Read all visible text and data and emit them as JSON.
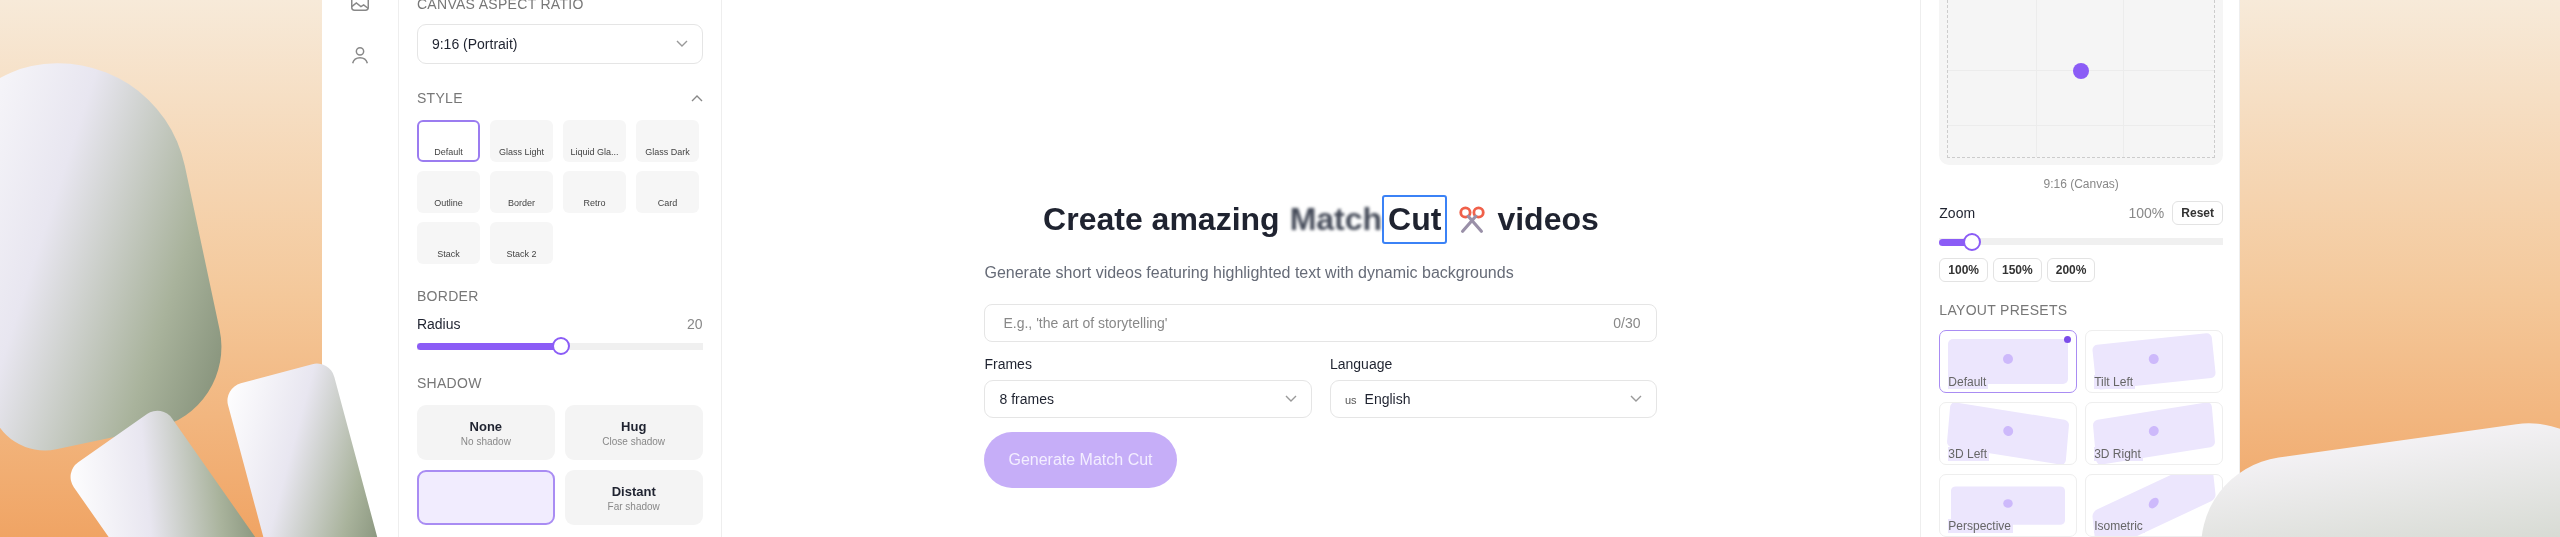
{
  "rail": {
    "items": [
      {
        "kind": "image"
      },
      {
        "kind": "person"
      }
    ]
  },
  "left_panel": {
    "aspect_ratio": {
      "heading": "CANVAS ASPECT RATIO",
      "value": "9:16 (Portrait)"
    },
    "style": {
      "heading": "STYLE",
      "expanded": true,
      "options": [
        {
          "label": "Default",
          "selected": true
        },
        {
          "label": "Glass Light",
          "selected": false
        },
        {
          "label": "Liquid Gla...",
          "selected": false
        },
        {
          "label": "Glass Dark",
          "selected": false
        },
        {
          "label": "Outline",
          "selected": false
        },
        {
          "label": "Border",
          "selected": false
        },
        {
          "label": "Retro",
          "selected": false
        },
        {
          "label": "Card",
          "selected": false
        },
        {
          "label": "Stack",
          "selected": false
        },
        {
          "label": "Stack 2",
          "selected": false
        }
      ]
    },
    "border": {
      "heading": "BORDER",
      "label": "Radius",
      "reading": "20",
      "level": 0.5
    },
    "shadow": {
      "heading": "SHADOW",
      "options": [
        {
          "label": "None",
          "hint": "No shadow",
          "selected": false
        },
        {
          "label": "Hug",
          "hint": "Close shadow",
          "selected": false
        },
        {
          "selected": true
        },
        {
          "label": "Distant",
          "hint": "Far shadow",
          "selected": false
        }
      ]
    }
  },
  "main": {
    "title": {
      "before": "Create amazing",
      "blurred": "Match",
      "framed": "Cut",
      "after": "videos"
    },
    "subtitle": "Generate short videos featuring highlighted text with dynamic backgrounds",
    "text_input": {
      "placeholder": "E.g., 'the art of storytelling'",
      "counter": "0/30"
    },
    "frames": {
      "label": "Frames",
      "value": "8 frames"
    },
    "language": {
      "label": "Language",
      "flag": "us",
      "value": "English"
    },
    "generate_button": {
      "label": "Generate Match Cut",
      "disabled": true
    }
  },
  "right_panel": {
    "preview_caption": "9:16 (Canvas)",
    "zoom": {
      "label": "Zoom",
      "reading": "100%",
      "reset": "Reset",
      "level": 0.11,
      "presets": [
        "100%",
        "150%",
        "200%"
      ]
    },
    "layout_presets": {
      "heading": "LAYOUT PRESETS",
      "items": [
        {
          "label": "Default",
          "kind": "flat",
          "selected": true
        },
        {
          "label": "Tilt Left",
          "kind": "tilted",
          "selected": false
        },
        {
          "label": "3D Left",
          "kind": "leftturn",
          "selected": false
        },
        {
          "label": "3D Right",
          "kind": "rightturn",
          "selected": false
        },
        {
          "label": "Perspective",
          "kind": "perspective",
          "selected": false
        },
        {
          "label": "Isometric",
          "kind": "isometric",
          "selected": false
        }
      ]
    }
  }
}
